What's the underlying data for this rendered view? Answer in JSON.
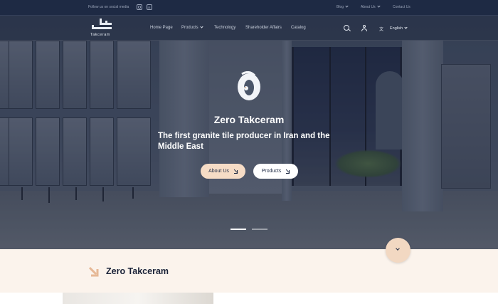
{
  "topbar": {
    "social_text": "Follow us on social media",
    "social_icons": [
      "instagram-icon",
      "linkedin-icon"
    ],
    "links": [
      "Blog",
      "About Us",
      "Contact Us"
    ]
  },
  "nav": {
    "logo_word": "Takceram",
    "items": [
      "Home Page",
      "Products",
      "Technology",
      "Shareholder Affairs",
      "Catalog"
    ],
    "language": "English"
  },
  "hero": {
    "title": "Zero Takceram",
    "subtitle": "The first granite tile producer in Iran and the Middle East",
    "buttons": [
      "About Us",
      "Products"
    ]
  },
  "section": {
    "title": "Zero Takceram"
  },
  "colors": {
    "navy": "#1e2a44",
    "peach": "#f6dcc6",
    "cream": "#fbf3ec",
    "accent": "#e6b896"
  }
}
